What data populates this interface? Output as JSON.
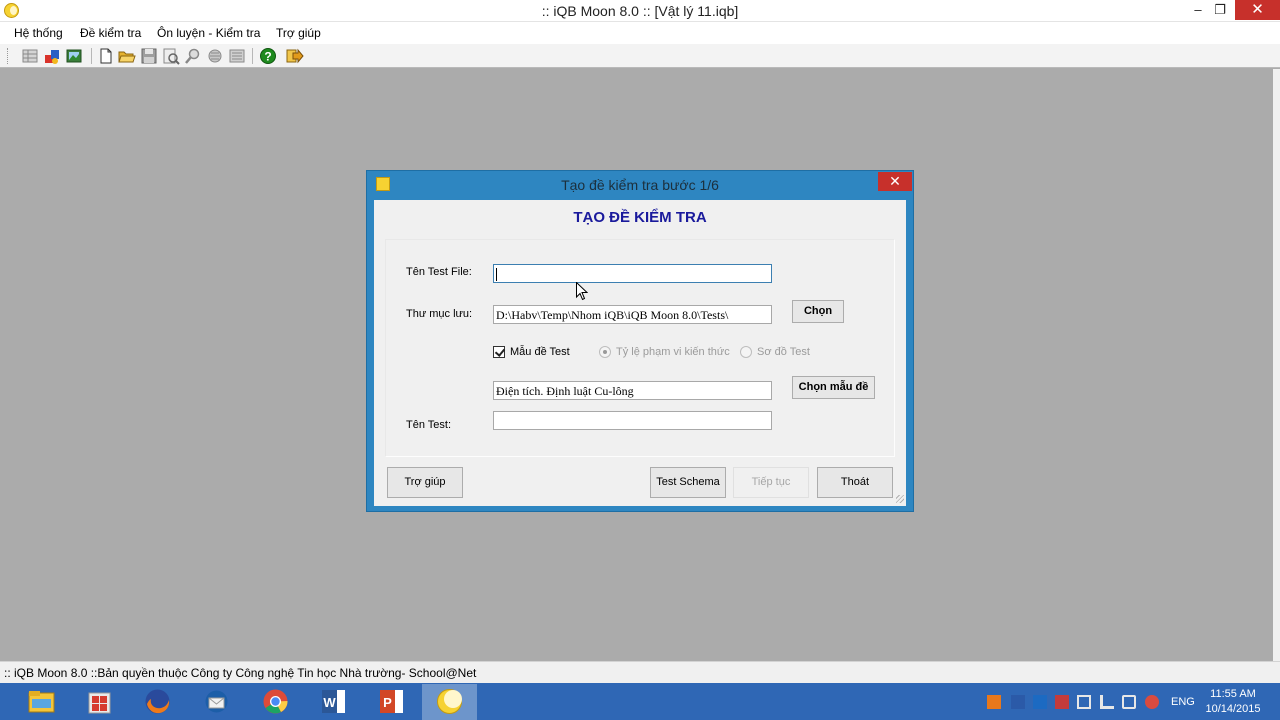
{
  "window": {
    "title": ":: iQB Moon 8.0 :: [Vật lý 11.iqb]",
    "minimize_glyph": "–",
    "restore_glyph": "❐",
    "close_glyph": "✕"
  },
  "menu": {
    "items": [
      {
        "label": "Hệ thống"
      },
      {
        "label": "Đề kiểm tra"
      },
      {
        "label": "Ôn luyện - Kiểm tra"
      },
      {
        "label": "Trợ giúp"
      }
    ]
  },
  "toolbar": {
    "icons": [
      "grid-icon",
      "tools-icon",
      "image-icon",
      "new-file-icon",
      "open-folder-icon",
      "save-icon",
      "preview-icon",
      "search-icon",
      "filter-icon",
      "list-icon",
      "help-icon",
      "exit-icon"
    ]
  },
  "dialog": {
    "title": "Tạo đề kiểm tra bước 1/6",
    "close_glyph": "✕",
    "heading": "TẠO ĐỀ KIỂM TRA",
    "test_file_label": "Tên Test File:",
    "test_file_value": "",
    "folder_label": "Thư mục lưu:",
    "folder_value": "D:\\Habv\\Temp\\Nhom iQB\\iQB Moon 8.0\\Tests\\",
    "choose_button": "Chọn",
    "template_checkbox_label": "Mẫu đề Test",
    "template_checked": true,
    "radio_ratio_label": "Tỷ lệ phạm vi kiến thức",
    "radio_diagram_label": "Sơ đồ Test",
    "template_value": "Điện tích. Định luật Cu-lông",
    "choose_template_button": "Chọn mẫu đề",
    "test_name_label": "Tên Test:",
    "test_name_value": "",
    "help_button": "Trợ giúp",
    "schema_button": "Test Schema",
    "continue_button": "Tiếp tục",
    "exit_button": "Thoát"
  },
  "status": {
    "text": ":: iQB Moon 8.0 ::Bản quyền thuộc Công ty Công nghệ Tin học Nhà trường- School@Net"
  },
  "taskbar": {
    "apps": [
      "file-explorer-icon",
      "store-icon",
      "firefox-icon",
      "thunderbird-icon",
      "chrome-icon",
      "word-icon",
      "powerpoint-icon",
      "iqb-moon-icon"
    ],
    "language": "ENG",
    "time": "11:55 AM",
    "date": "10/14/2015"
  },
  "colors": {
    "dialog_frame": "#2e86c1",
    "heading": "#1a1a9c",
    "close_red": "#c7302b",
    "taskbar": "#2f67b5",
    "workspace": "#ababab"
  }
}
